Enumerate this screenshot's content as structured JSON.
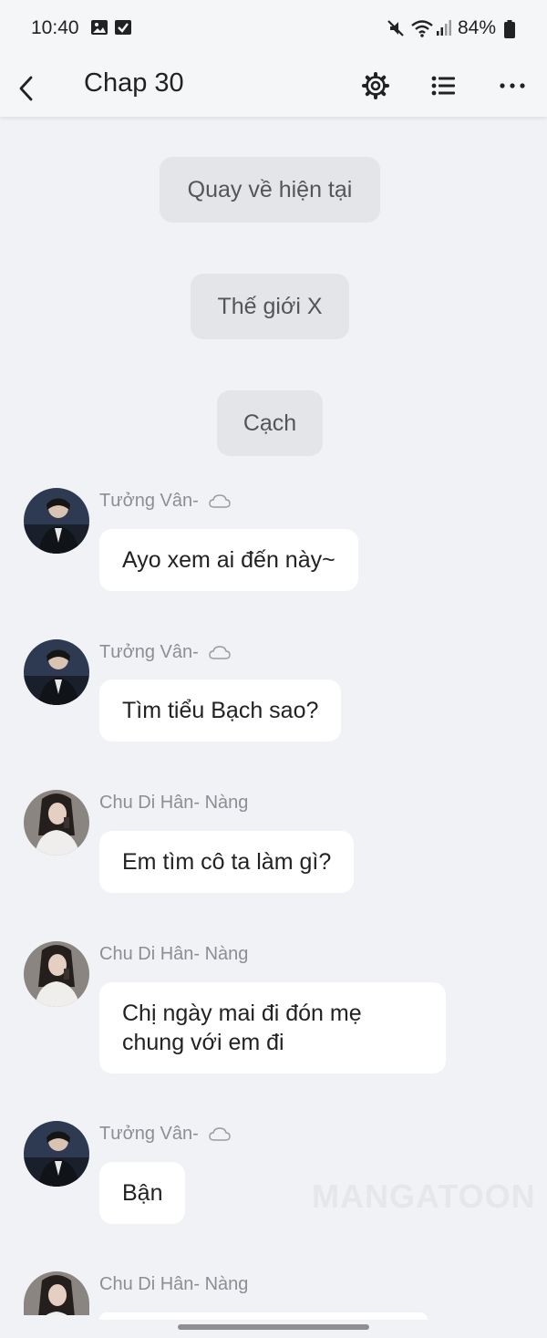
{
  "status_bar": {
    "time": "10:40",
    "battery": "84%",
    "icons": [
      "image-icon",
      "checkbox-icon",
      "mute-icon",
      "wifi-icon",
      "signal-icon",
      "battery-icon"
    ]
  },
  "header": {
    "title": "Chap 30",
    "icons": [
      "back-arrow-icon",
      "gear-icon",
      "list-icon",
      "more-icon"
    ]
  },
  "narrations": [
    {
      "text": "Quay về hiện tại"
    },
    {
      "text": "Thế giới X"
    },
    {
      "text": "Cạch"
    }
  ],
  "messages": [
    {
      "sender": "Tưởng Vân-",
      "badge": "cloud-icon",
      "text": "Ayo xem ai đến này~"
    },
    {
      "sender": "Tưởng Vân-",
      "badge": "cloud-icon",
      "text": "Tìm tiểu Bạch sao?"
    },
    {
      "sender": "Chu Di Hân- Nàng",
      "text": "Em tìm cô ta làm gì?"
    },
    {
      "sender": "Chu Di Hân- Nàng",
      "text_line1": "Chị ngày mai đi đón mẹ",
      "text_line2": "chung với em đi"
    },
    {
      "sender": "Tưởng Vân-",
      "badge": "cloud-icon",
      "text": "Bận"
    },
    {
      "sender": "Chu Di Hân- Nàng"
    }
  ],
  "watermark": "MANGATOON",
  "colors": {
    "background": "#f1f2f6",
    "bubble": "#ffffff",
    "narration": "#e4e5e9"
  }
}
